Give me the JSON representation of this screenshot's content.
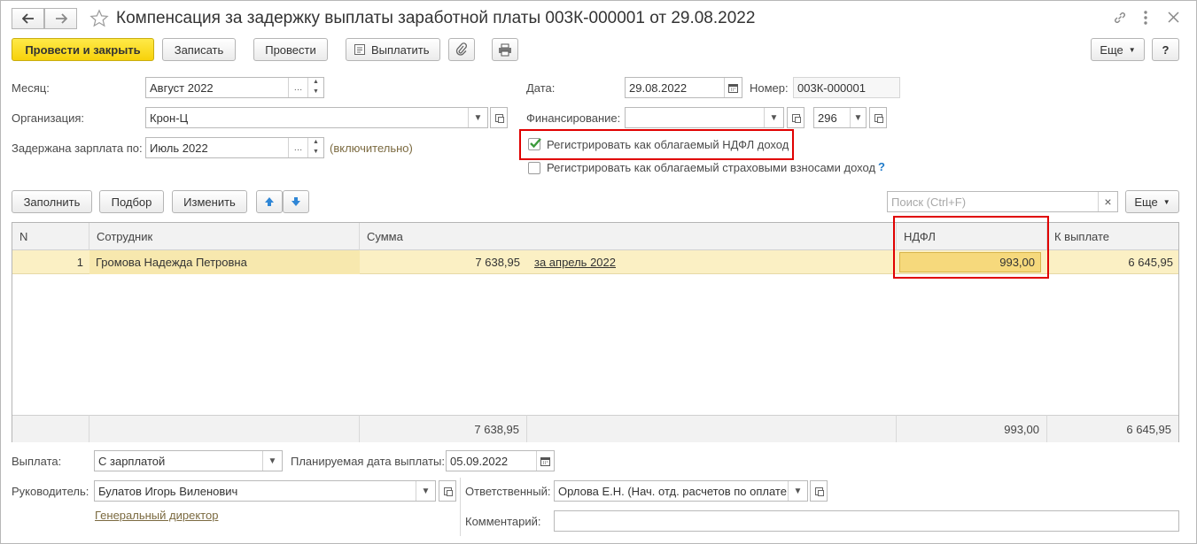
{
  "window": {
    "title": "Компенсация за задержку выплаты заработной платы 003К-000001 от 29.08.2022"
  },
  "toolbar": {
    "post_close": "Провести и закрыть",
    "save": "Записать",
    "post": "Провести",
    "pay": "Выплатить",
    "more": "Еще",
    "help": "?"
  },
  "header": {
    "month_label": "Месяц:",
    "month_value": "Август 2022",
    "org_label": "Организация:",
    "org_value": "Крон-Ц",
    "delayed_label": "Задержана зарплата по:",
    "delayed_value": "Июль 2022",
    "delayed_hint": "(включительно)",
    "date_label": "Дата:",
    "date_value": "29.08.2022",
    "number_label": "Номер:",
    "number_value": "003К-000001",
    "financing_label": "Финансирование:",
    "financing_value": "",
    "financing_code": "296",
    "ndfl_check_label": "Регистрировать как облагаемый НДФЛ доход",
    "ndfl_checked": true,
    "ins_check_label": "Регистрировать как облагаемый страховыми взносами доход",
    "ins_checked": false,
    "ins_help": "?"
  },
  "table_toolbar": {
    "fill": "Заполнить",
    "select": "Подбор",
    "change": "Изменить",
    "search_placeholder": "Поиск (Ctrl+F)",
    "search_clear": "×",
    "more": "Еще"
  },
  "table": {
    "columns": [
      "N",
      "Сотрудник",
      "Сумма",
      "НДФЛ",
      "К выплате"
    ],
    "rows": [
      {
        "n": "1",
        "employee": "Громова Надежда Петровна",
        "sum": "7 638,95",
        "period": "за апрель 2022",
        "ndfl": "993,00",
        "payout": "6 645,95"
      }
    ],
    "totals": {
      "sum": "7 638,95",
      "ndfl": "993,00",
      "payout": "6 645,95"
    }
  },
  "footer": {
    "payment_label": "Выплата:",
    "payment_value": "С зарплатой",
    "planned_date_label": "Планируемая дата выплаты:",
    "planned_date_value": "05.09.2022",
    "manager_label": "Руководитель:",
    "manager_value": "Булатов Игорь Виленович",
    "manager_position": "Генеральный директор",
    "responsible_label": "Ответственный:",
    "responsible_value": "Орлова Е.Н. (Нач. отд. расчетов по оплате",
    "comment_label": "Комментарий:",
    "comment_value": ""
  },
  "colors": {
    "primary_button": "#f7d20a",
    "selected_row": "#fbf0c4",
    "highlight": "#e00000",
    "checkbox_mark": "#3c9a3c"
  }
}
